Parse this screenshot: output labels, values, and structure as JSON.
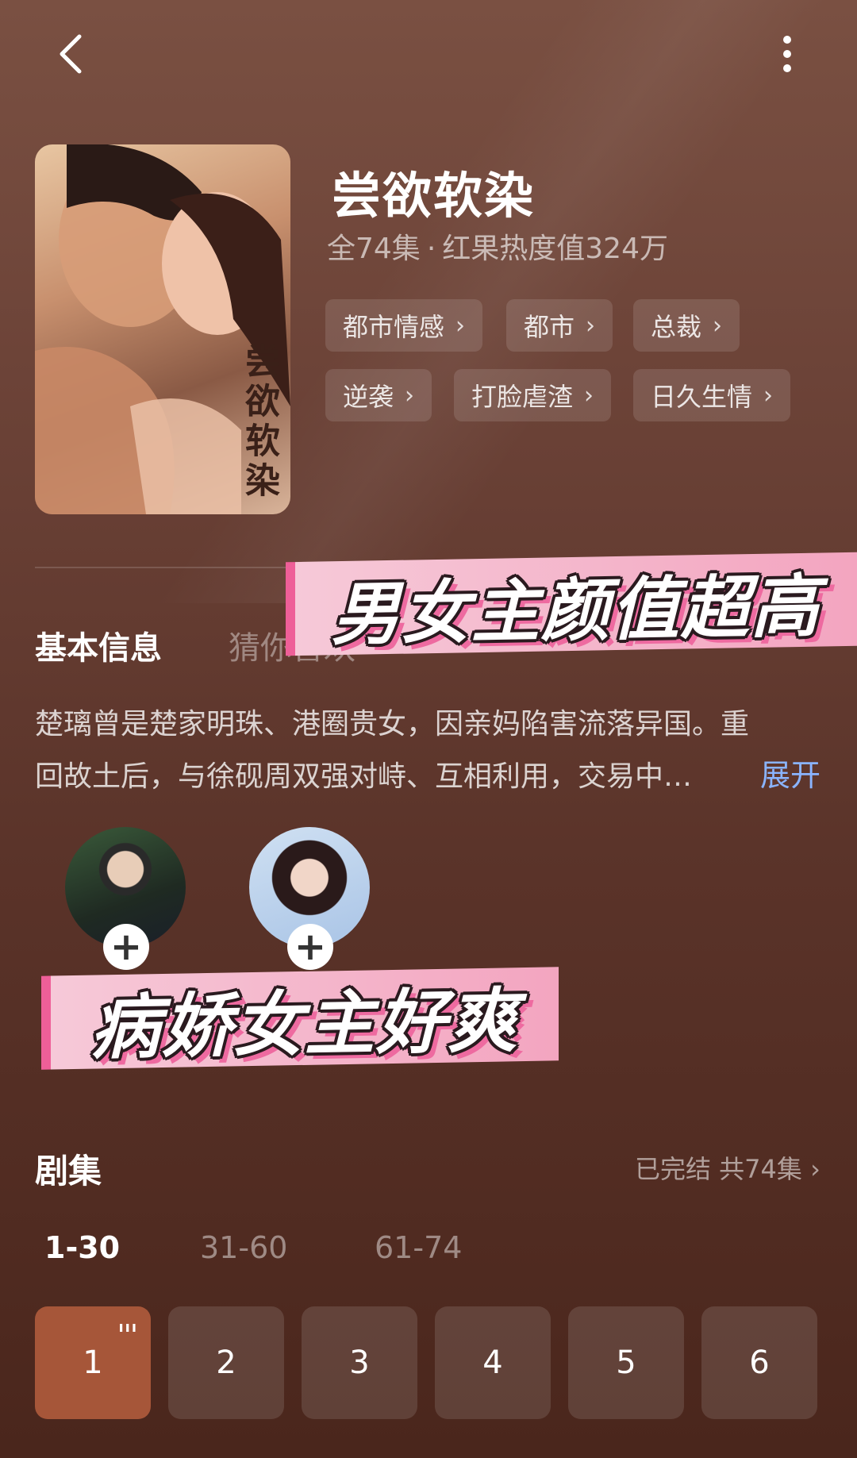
{
  "topbar": {
    "back_icon": "chevron-left-icon",
    "more_icon": "more-vertical-icon"
  },
  "drama": {
    "title": "尝欲软染",
    "episodes_text": "全74集",
    "separator": "·",
    "heat_text": "红果热度值324万",
    "poster_title": "尝欲软染",
    "tags": [
      {
        "label": "都市情感"
      },
      {
        "label": "都市"
      },
      {
        "label": "总裁"
      },
      {
        "label": "逆袭"
      },
      {
        "label": "打脸虐渣"
      },
      {
        "label": "日久生情"
      }
    ]
  },
  "stickers": {
    "top": "男女主颜值超高",
    "bottom": "病娇女主好爽"
  },
  "info_tabs": {
    "basic": "基本信息",
    "guess": "猜你喜欢"
  },
  "synopsis": {
    "text": "楚璃曾是楚家明珠、港圈贵女，因亲妈陷害流落异国。重回故土后，与徐砚周双强对峙、互相利用，交易中…",
    "expand_label": "展开"
  },
  "cast": [
    {
      "avatar": "actor-avatar"
    },
    {
      "avatar": "actress-avatar"
    }
  ],
  "episodes": {
    "section_title": "剧集",
    "status": "已完结 共74集",
    "ranges": [
      "1-30",
      "31-60",
      "61-74"
    ],
    "active_range": "1-30",
    "items": [
      "1",
      "2",
      "3",
      "4",
      "5",
      "6"
    ],
    "playing_indicator": "ııı"
  },
  "colors": {
    "accent_current_episode": "#a65639",
    "link_blue": "#8ab4ff",
    "sticker_pink": "#ee5f98"
  }
}
